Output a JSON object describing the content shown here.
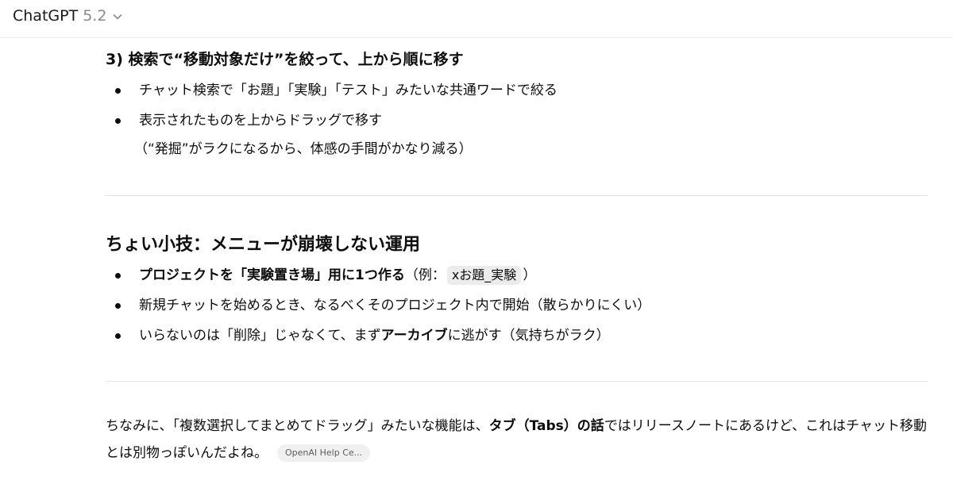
{
  "header": {
    "model_name": "ChatGPT",
    "model_version": "5.2",
    "chevron_icon": "chevron-down-icon"
  },
  "section3": {
    "heading": "3) 検索で“移動対象だけ”を絞って、上から順に移す",
    "bullets": [
      "チャット検索で「お題」「実験」「テスト」みたいな共通ワードで絞る",
      "表示されたものを上からドラッグで移す"
    ],
    "bullet2_sub": "（“発掘”がラクになるから、体感の手間がかなり減る）"
  },
  "tip": {
    "heading": "ちょい小技：メニューが崩壊しない運用",
    "item1": {
      "bold": "プロジェクトを「実験置き場」用に1つ作る",
      "pre_code": "（例：",
      "code": "xお題_実験",
      "post_code": "）"
    },
    "item2": "新規チャットを始めるとき、なるべくそのプロジェクト内で開始（散らかりにくい）",
    "item3": {
      "pre": "いらないのは「削除」じゃなくて、まず",
      "bold": "アーカイブ",
      "post": "に逃がす（気持ちがラク）"
    }
  },
  "note": {
    "pre": "ちなみに、「複数選択してまとめてドラッグ」みたいな機能は、",
    "bold": "タブ（Tabs）の話",
    "post": "ではリリースノートにあるけど、これはチャット移動とは別物っぽいんだよね。",
    "citation": "OpenAI Help Ce..."
  }
}
